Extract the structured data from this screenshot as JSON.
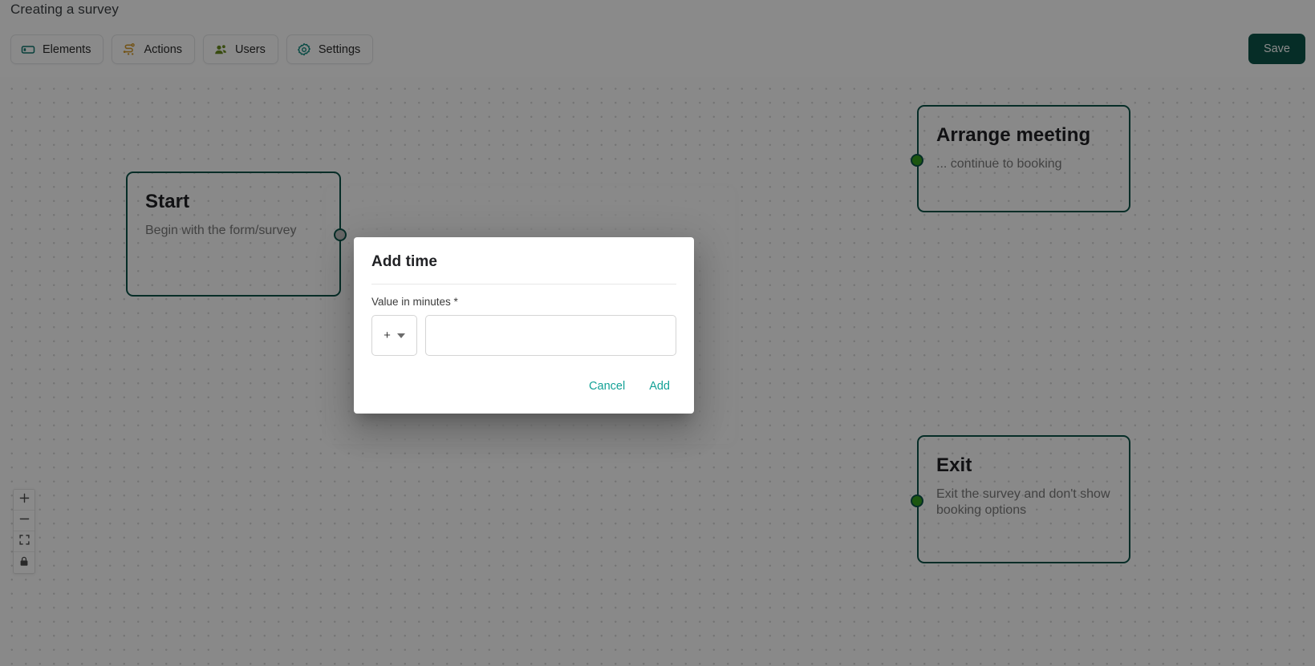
{
  "header": {
    "title": "Creating a survey",
    "save_label": "Save",
    "tabs": [
      {
        "label": "Elements",
        "icon": "elements-icon",
        "color": "#0f766e"
      },
      {
        "label": "Actions",
        "icon": "actions-icon",
        "color": "#d49a2a"
      },
      {
        "label": "Users",
        "icon": "users-icon",
        "color": "#6a8c1f"
      },
      {
        "label": "Settings",
        "icon": "gear-icon",
        "color": "#0f8a7e"
      }
    ]
  },
  "canvas": {
    "nodes": [
      {
        "title": "Start",
        "desc": "Begin with the form/survey"
      },
      {
        "title": "Arrange meeting",
        "desc": "... continue to booking"
      },
      {
        "title": "Exit",
        "desc": "Exit the survey and don't show booking options"
      }
    ],
    "controls": [
      {
        "name": "zoom-in-button",
        "glyph": "+"
      },
      {
        "name": "zoom-out-button",
        "glyph": "−"
      },
      {
        "name": "fit-view-button",
        "glyph": "fit-view-icon"
      },
      {
        "name": "lock-button",
        "glyph": "lock-icon"
      }
    ]
  },
  "modal": {
    "title": "Add time",
    "field_label": "Value in minutes *",
    "sign_value": "+",
    "sign_options": [
      "+",
      "-"
    ],
    "value": "",
    "value_placeholder": "",
    "cancel_label": "Cancel",
    "add_label": "Add"
  },
  "colors": {
    "accent_teal": "#0c5449",
    "link_teal": "#13a196",
    "handle_green": "#35a01e"
  }
}
